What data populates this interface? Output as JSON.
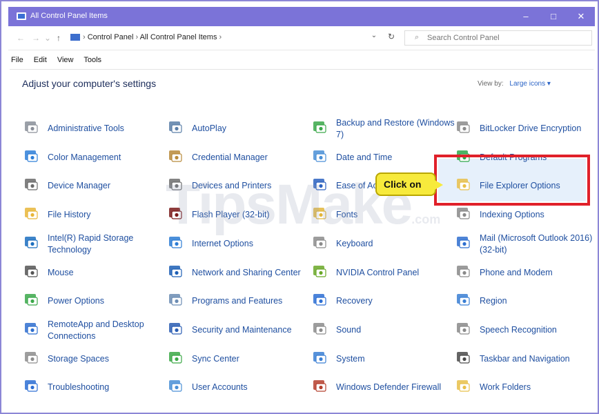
{
  "window": {
    "title": "All Control Panel Items",
    "controls": [
      "–",
      "□",
      "✕"
    ]
  },
  "nav": {
    "breadcrumb": [
      "Control Panel",
      "All Control Panel Items"
    ],
    "search_placeholder": "Search Control Panel"
  },
  "menu": [
    "File",
    "Edit",
    "View",
    "Tools"
  ],
  "heading": "Adjust your computer's settings",
  "view_by": {
    "label": "View by:",
    "value": "Large icons ▾"
  },
  "callout": "Click on",
  "watermark": {
    "main": "TipsMake",
    "sub": ".com"
  },
  "items": [
    {
      "label": "Administrative Tools",
      "icon": "admin-tools-icon",
      "color": "#8a8f99"
    },
    {
      "label": "Color Management",
      "icon": "color-management-icon",
      "color": "#2f7fd8"
    },
    {
      "label": "Device Manager",
      "icon": "device-manager-icon",
      "color": "#6b6b6b"
    },
    {
      "label": "File History",
      "icon": "file-history-icon",
      "color": "#e8b63a"
    },
    {
      "label": "Intel(R) Rapid Storage Technology",
      "icon": "intel-storage-icon",
      "color": "#1c6fbf"
    },
    {
      "label": "Mouse",
      "icon": "mouse-icon",
      "color": "#555"
    },
    {
      "label": "Power Options",
      "icon": "power-options-icon",
      "color": "#3ba84a"
    },
    {
      "label": "RemoteApp and Desktop Connections",
      "icon": "remoteapp-icon",
      "color": "#2f6fcf"
    },
    {
      "label": "Storage Spaces",
      "icon": "storage-spaces-icon",
      "color": "#8d8d8d"
    },
    {
      "label": "Troubleshooting",
      "icon": "troubleshooting-icon",
      "color": "#2d6fd4"
    },
    {
      "label": "AutoPlay",
      "icon": "autoplay-icon",
      "color": "#5b7fa8"
    },
    {
      "label": "Credential Manager",
      "icon": "credential-manager-icon",
      "color": "#b88a3a"
    },
    {
      "label": "Devices and Printers",
      "icon": "devices-printers-icon",
      "color": "#6d6d6d"
    },
    {
      "label": "Flash Player (32-bit)",
      "icon": "flash-player-icon",
      "color": "#7a1a1a"
    },
    {
      "label": "Internet Options",
      "icon": "internet-options-icon",
      "color": "#2b7bd4"
    },
    {
      "label": "Network and Sharing Center",
      "icon": "network-sharing-icon",
      "color": "#1d5fb5"
    },
    {
      "label": "Programs and Features",
      "icon": "programs-features-icon",
      "color": "#6b8cb3"
    },
    {
      "label": "Security and Maintenance",
      "icon": "security-maintenance-icon",
      "color": "#2a5db3"
    },
    {
      "label": "Sync Center",
      "icon": "sync-center-icon",
      "color": "#3aa845"
    },
    {
      "label": "User Accounts",
      "icon": "user-accounts-icon",
      "color": "#4a8fd6"
    },
    {
      "label": "Backup and Restore (Windows 7)",
      "icon": "backup-restore-icon",
      "color": "#3ba84a"
    },
    {
      "label": "Date and Time",
      "icon": "date-time-icon",
      "color": "#4a8fd6"
    },
    {
      "label": "Ease of Access Center",
      "icon": "ease-of-access-icon",
      "color": "#2c62c0"
    },
    {
      "label": "Fonts",
      "icon": "fonts-icon",
      "color": "#e2b63b"
    },
    {
      "label": "Keyboard",
      "icon": "keyboard-icon",
      "color": "#8c8c8c"
    },
    {
      "label": "NVIDIA Control Panel",
      "icon": "nvidia-icon",
      "color": "#6aa828"
    },
    {
      "label": "Recovery",
      "icon": "recovery-icon",
      "color": "#2d6fd4"
    },
    {
      "label": "Sound",
      "icon": "sound-icon",
      "color": "#8c8c8c"
    },
    {
      "label": "System",
      "icon": "system-icon",
      "color": "#3a7fd4"
    },
    {
      "label": "Windows Defender Firewall",
      "icon": "firewall-icon",
      "color": "#b5402e"
    },
    {
      "label": "BitLocker Drive Encryption",
      "icon": "bitlocker-icon",
      "color": "#8c8c8c"
    },
    {
      "label": "Default Programs",
      "icon": "default-programs-icon",
      "color": "#2fa84a"
    },
    {
      "label": "File Explorer Options",
      "icon": "file-explorer-options-icon",
      "color": "#e8c04a"
    },
    {
      "label": "Indexing Options",
      "icon": "indexing-options-icon",
      "color": "#8a8a8a"
    },
    {
      "label": "Mail (Microsoft Outlook 2016) (32-bit)",
      "icon": "mail-icon",
      "color": "#2f6fcf"
    },
    {
      "label": "Phone and Modem",
      "icon": "phone-modem-icon",
      "color": "#8a8a8a"
    },
    {
      "label": "Region",
      "icon": "region-icon",
      "color": "#3a7fd4"
    },
    {
      "label": "Speech Recognition",
      "icon": "speech-recognition-icon",
      "color": "#8a8a8a"
    },
    {
      "label": "Taskbar and Navigation",
      "icon": "taskbar-navigation-icon",
      "color": "#4a4a4a"
    },
    {
      "label": "Work Folders",
      "icon": "work-folders-icon",
      "color": "#e8c04a"
    }
  ]
}
